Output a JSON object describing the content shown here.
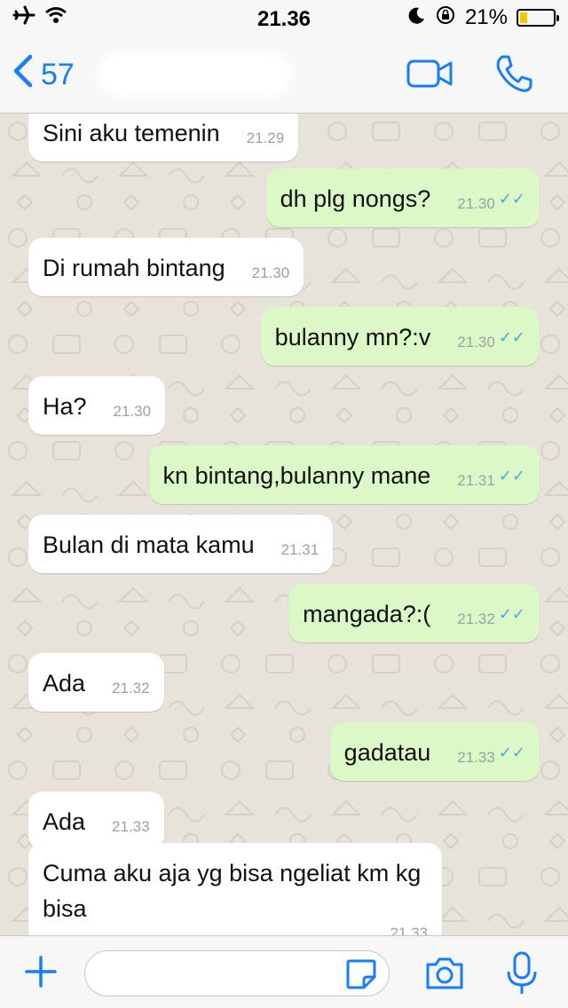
{
  "status": {
    "time": "21.36",
    "battery_text": "21%",
    "battery_level": 0.21,
    "battery_color": "#f7c600"
  },
  "header": {
    "back_count": "57",
    "icons": [
      "chevron-left-icon",
      "video-camera-icon",
      "phone-icon"
    ],
    "accent_color": "#157efb"
  },
  "messages": [
    {
      "dir": "in",
      "text": "Sini aku temenin",
      "time": "21.29"
    },
    {
      "dir": "out",
      "text": "dh plg nongs?",
      "time": "21.30"
    },
    {
      "dir": "in",
      "text": "Di rumah bintang",
      "time": "21.30"
    },
    {
      "dir": "out",
      "text": "bulanny mn?:v",
      "time": "21.30"
    },
    {
      "dir": "in",
      "text": "Ha?",
      "time": "21.30"
    },
    {
      "dir": "out",
      "text": "kn bintang,bulanny mane",
      "time": "21.31"
    },
    {
      "dir": "in",
      "text": "Bulan di mata kamu",
      "time": "21.31"
    },
    {
      "dir": "out",
      "text": "mangada?:(",
      "time": "21.32"
    },
    {
      "dir": "in",
      "text": "Ada",
      "time": "21.32"
    },
    {
      "dir": "out",
      "text": "gadatau",
      "time": "21.33"
    },
    {
      "dir": "in",
      "text": "Ada",
      "time": "21.33"
    },
    {
      "dir": "in",
      "text": "Cuma aku aja yg bisa ngeliat km kg bisa",
      "time": "21.33"
    }
  ],
  "colors": {
    "incoming_bubble": "#ffffff",
    "outgoing_bubble": "#dcf8c6",
    "read_ticks": "#4fa7e0"
  },
  "input": {
    "value": "",
    "placeholder": ""
  }
}
